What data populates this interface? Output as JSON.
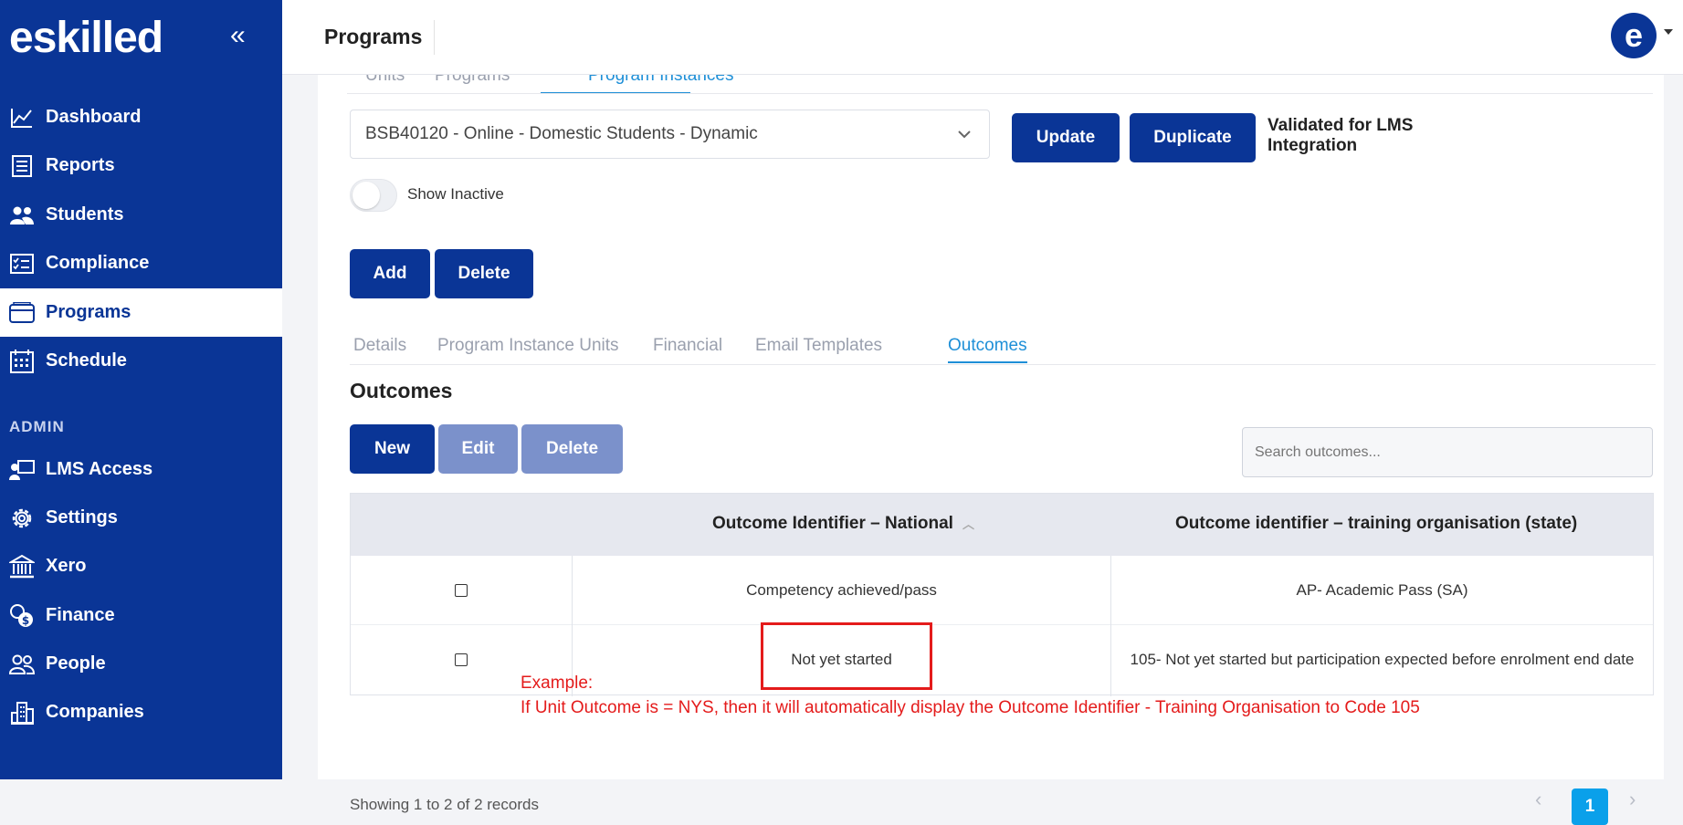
{
  "brand": {
    "logo_text": "eskilled",
    "collapse_label": "«"
  },
  "sidebar": {
    "items": [
      {
        "label": "Dashboard",
        "icon": "chart-line-icon"
      },
      {
        "label": "Reports",
        "icon": "report-icon"
      },
      {
        "label": "Students",
        "icon": "users-icon"
      },
      {
        "label": "Compliance",
        "icon": "checklist-icon"
      },
      {
        "label": "Programs",
        "icon": "card-icon",
        "active": true
      },
      {
        "label": "Schedule",
        "icon": "calendar-icon"
      }
    ],
    "admin_label": "ADMIN",
    "admin_items": [
      {
        "label": "LMS Access",
        "icon": "presenter-icon"
      },
      {
        "label": "Settings",
        "icon": "gear-icon"
      },
      {
        "label": "Xero",
        "icon": "bank-icon"
      },
      {
        "label": "Finance",
        "icon": "coins-icon"
      },
      {
        "label": "People",
        "icon": "people-icon"
      },
      {
        "label": "Companies",
        "icon": "building-icon"
      }
    ]
  },
  "header": {
    "title": "Programs",
    "avatar_letter": "e"
  },
  "top_tabs": [
    "Units",
    "Programs",
    "Program Instances"
  ],
  "program_select": {
    "value": "BSB40120 - Online - Domestic Students - Dynamic"
  },
  "buttons": {
    "update": "Update",
    "duplicate": "Duplicate",
    "add": "Add",
    "delete": "Delete",
    "new": "New",
    "edit": "Edit",
    "delete2": "Delete"
  },
  "validated_text": "Validated for LMS Integration",
  "show_inactive_label": "Show Inactive",
  "sub_tabs": [
    "Details",
    "Program Instance Units",
    "Financial",
    "Email Templates",
    "Outcomes"
  ],
  "outcomes": {
    "title": "Outcomes",
    "search_placeholder": "Search outcomes...",
    "columns": [
      "Outcome Identifier – National",
      "Outcome identifier – training organisation (state)"
    ],
    "rows": [
      {
        "national": "Competency achieved/pass",
        "state": "AP- Academic Pass (SA)"
      },
      {
        "national": "Not yet started",
        "state": "105- Not yet started but participation expected before enrolment end date"
      }
    ],
    "showing": "Showing 1 to 2 of 2 records",
    "pagination": {
      "current": "1",
      "prev": "‹",
      "next": "›"
    }
  },
  "annotation": {
    "line1": "Example:",
    "line2": "If Unit Outcome is = NYS, then it will automatically display the Outcome Identifier - Training Organisation to Code 105"
  },
  "colors": {
    "brand": "#0a3596",
    "accent": "#1e8fd7",
    "annotation": "#e41b1b",
    "page_active": "#0aa0ea"
  }
}
